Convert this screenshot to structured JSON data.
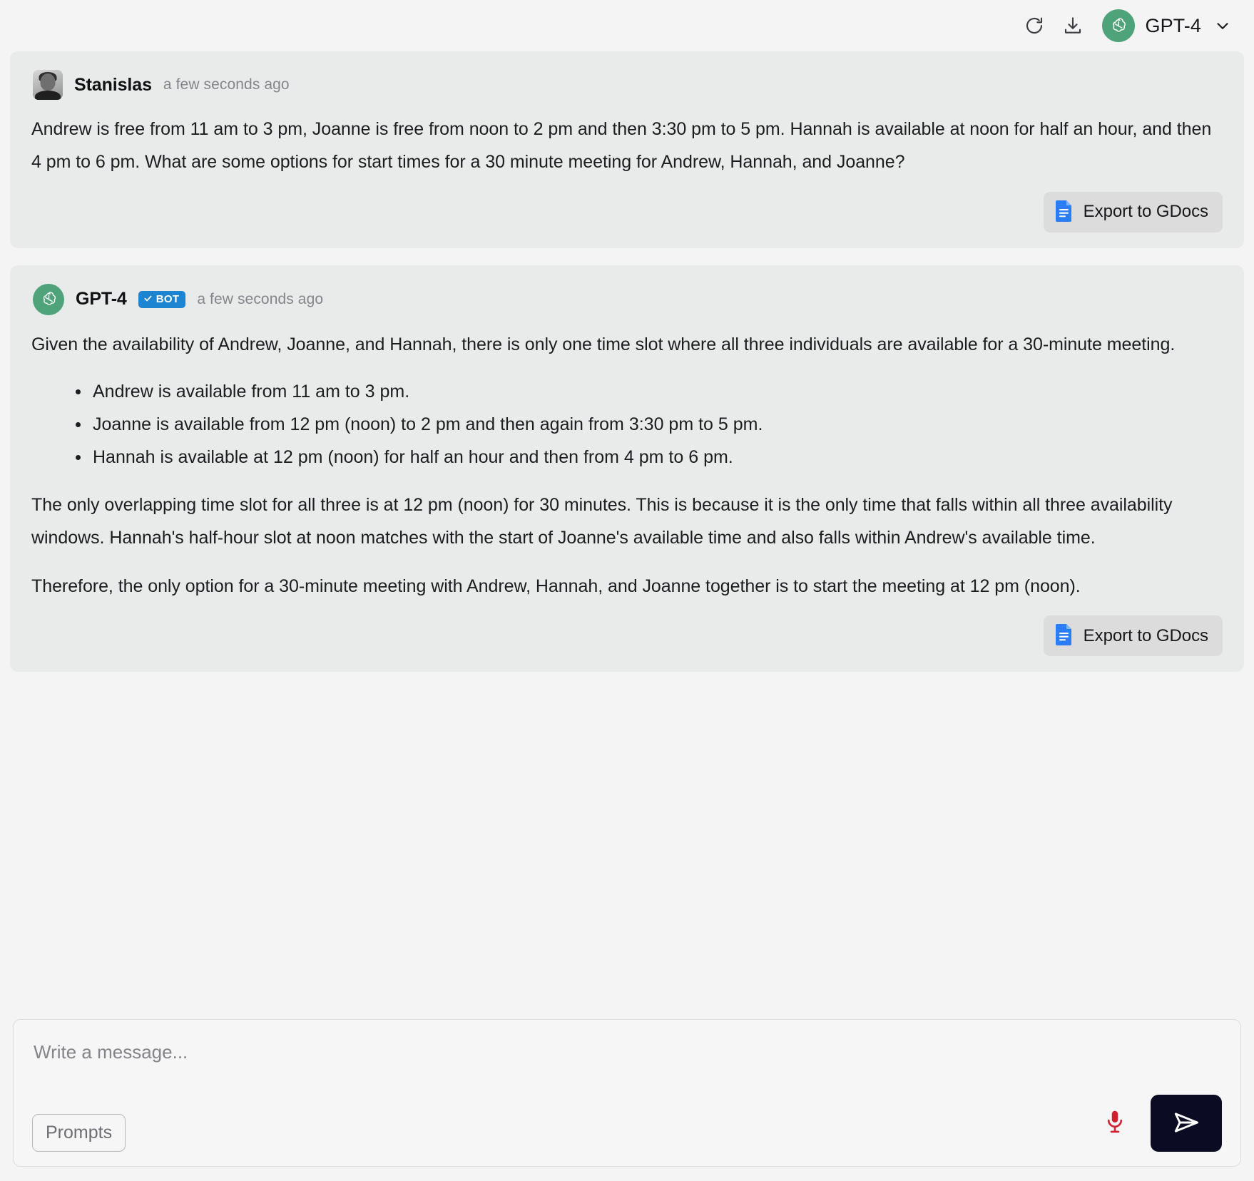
{
  "header": {
    "refresh_icon": "refresh-icon",
    "download_icon": "download-icon",
    "model_label": "GPT-4",
    "model_logo": "openai-logo-icon",
    "chevron_icon": "chevron-down-icon"
  },
  "messages": [
    {
      "sender": "Stanislas",
      "is_bot": false,
      "avatar": "user-photo-avatar",
      "timestamp": "a few seconds ago",
      "paragraphs": [
        "Andrew is free from 11 am to 3 pm, Joanne is free from noon to 2 pm and then 3:30 pm to 5 pm. Hannah is available at noon for half an hour, and then 4 pm to 6 pm. What are some options for start times for a 30 minute meeting for Andrew, Hannah, and Joanne?"
      ],
      "bullets": [],
      "paragraphs_after": [],
      "action_label": "Export to GDocs",
      "action_icon": "google-docs-icon"
    },
    {
      "sender": "GPT-4",
      "is_bot": true,
      "avatar": "openai-logo-icon",
      "badge_label": "BOT",
      "timestamp": "a few seconds ago",
      "paragraphs": [
        "Given the availability of Andrew, Joanne, and Hannah, there is only one time slot where all three individuals are available for a 30-minute meeting."
      ],
      "bullets": [
        "Andrew is available from 11 am to 3 pm.",
        "Joanne is available from 12 pm (noon) to 2 pm and then again from 3:30 pm to 5 pm.",
        "Hannah is available at 12 pm (noon) for half an hour and then from 4 pm to 6 pm."
      ],
      "paragraphs_after": [
        "The only overlapping time slot for all three is at 12 pm (noon) for 30 minutes. This is because it is the only time that falls within all three availability windows. Hannah's half-hour slot at noon matches with the start of Joanne's available time and also falls within Andrew's available time.",
        "Therefore, the only option for a 30-minute meeting with Andrew, Hannah, and Joanne together is to start the meeting at 12 pm (noon)."
      ],
      "action_label": "Export to GDocs",
      "action_icon": "google-docs-icon"
    }
  ],
  "composer": {
    "placeholder": "Write a message...",
    "value": "",
    "prompts_label": "Prompts",
    "mic_icon": "microphone-icon",
    "send_icon": "send-paper-plane-icon"
  },
  "colors": {
    "page_bg": "#f4f4f5",
    "bubble_bg": "#e9eaea",
    "bot_badge": "#1d84d1",
    "gdocs_blue": "#2b7cf7",
    "mic_red": "#d2202f",
    "send_dark": "#0b0b24",
    "openai_green": "#4fa37a"
  }
}
